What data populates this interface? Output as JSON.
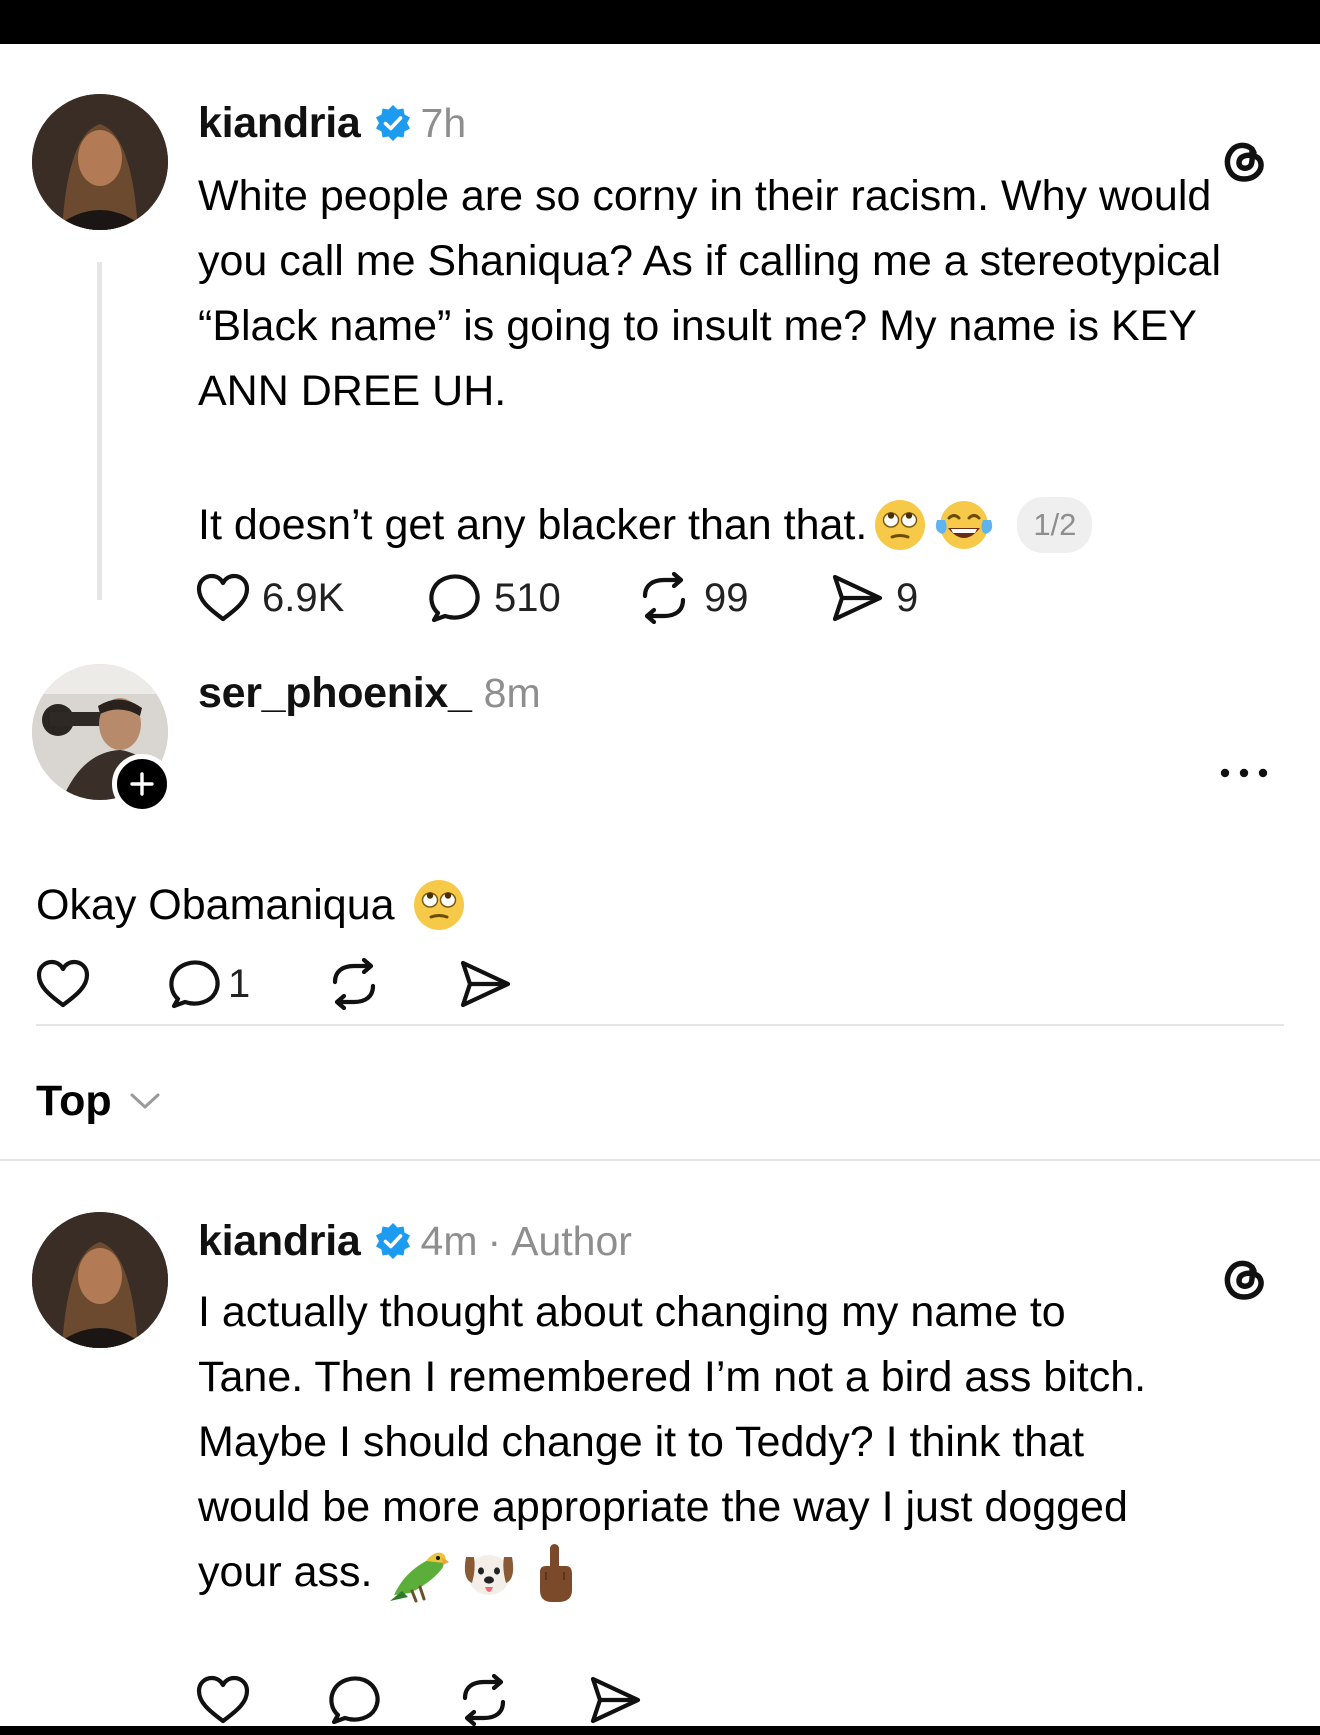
{
  "post": {
    "username": "kiandria",
    "time": "7h",
    "paragraph1": "White people are so corny in their racism. Why would you call me Shaniqua? As if calling me a stereotypical “Black name” is going to insult me? My name is KEY ANN DREE UH.",
    "paragraph2": "It doesn’t get any blacker than that.",
    "paragraph2_emojis": [
      "rolling-eyes-emoji",
      "tears-of-joy-emoji"
    ],
    "page_indicator": "1/2",
    "likes": "6.9K",
    "replies": "510",
    "reposts": "99",
    "shares": "9"
  },
  "reply": {
    "username": "ser_phoenix_",
    "time": "8m",
    "text": "Okay Obamaniqua",
    "emoji": "rolling-eyes-emoji",
    "replies": "1"
  },
  "sort": {
    "label": "Top"
  },
  "author_reply": {
    "username": "kiandria",
    "time": "4m",
    "separator": "·",
    "badge": "Author",
    "lines": [
      "I actually thought about changing my name to",
      "Tane. Then I remembered I’m not a bird ass bitch.",
      "Maybe I should change it to Teddy? I think that",
      "would be more appropriate the way I just dogged",
      "your ass."
    ],
    "emojis": [
      "parrot-emoji",
      "dog-face-emoji",
      "middle-finger-emoji"
    ]
  },
  "colors": {
    "verified": "#1d9bf0",
    "muted": "#8e8e8e",
    "divider": "#e4e4e4"
  }
}
